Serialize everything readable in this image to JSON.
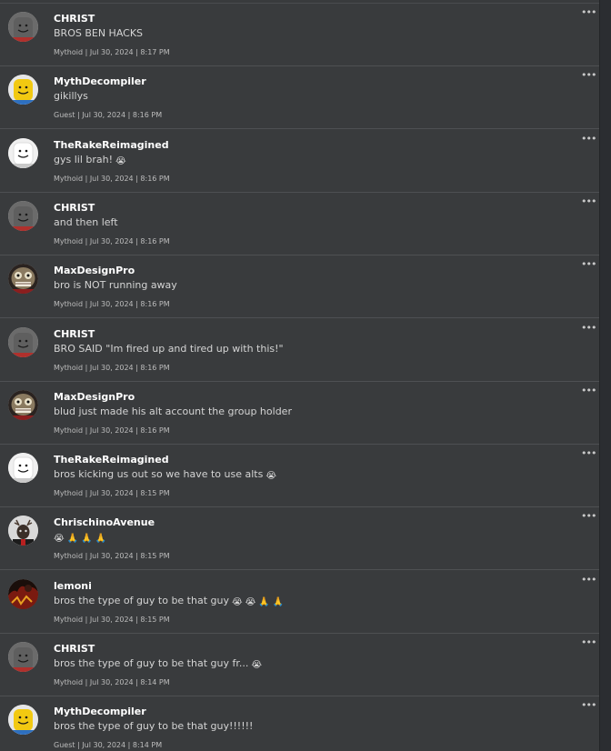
{
  "more_label": "•••",
  "comments": [
    {
      "user": "CHRIST",
      "text": "BROS BEN HACKS",
      "meta": "Mythoid | Jul 30, 2024 | 8:17 PM",
      "avatar": "gray-face",
      "emoji": []
    },
    {
      "user": "MythDecompiler",
      "text": "gikillys",
      "meta": "Guest | Jul 30, 2024 | 8:16 PM",
      "avatar": "yellow-face",
      "emoji": []
    },
    {
      "user": "TheRakeReimagined",
      "text": "gys lil brah!",
      "meta": "Mythoid | Jul 30, 2024 | 8:16 PM",
      "avatar": "white-face",
      "emoji": [
        "😭"
      ]
    },
    {
      "user": "CHRIST",
      "text": "and then left",
      "meta": "Mythoid | Jul 30, 2024 | 8:16 PM",
      "avatar": "gray-face",
      "emoji": []
    },
    {
      "user": "MaxDesignPro",
      "text": "bro is NOT running away",
      "meta": "Mythoid | Jul 30, 2024 | 8:16 PM",
      "avatar": "monster-face",
      "emoji": []
    },
    {
      "user": "CHRIST",
      "text": "BRO SAID \"Im fired up and tired up with this!\"",
      "meta": "Mythoid | Jul 30, 2024 | 8:16 PM",
      "avatar": "gray-face",
      "emoji": []
    },
    {
      "user": "MaxDesignPro",
      "text": "blud just made his alt account the group holder",
      "meta": "Mythoid | Jul 30, 2024 | 8:16 PM",
      "avatar": "monster-face",
      "emoji": []
    },
    {
      "user": "TheRakeReimagined",
      "text": "bros kicking us out so we have to use alts",
      "meta": "Mythoid | Jul 30, 2024 | 8:15 PM",
      "avatar": "white-face",
      "emoji": [
        "😭"
      ]
    },
    {
      "user": "ChrischinoAvenue",
      "text": "",
      "meta": "Mythoid | Jul 30, 2024 | 8:15 PM",
      "avatar": "deer-face",
      "emoji": [
        "😭",
        "🙏",
        "🙏",
        "🙏"
      ]
    },
    {
      "user": "lemoni",
      "text": "bros the type of guy to be that guy",
      "meta": "Mythoid | Jul 30, 2024 | 8:15 PM",
      "avatar": "dark-red-face",
      "emoji": [
        "😭",
        "😭",
        "🙏",
        "🙏"
      ]
    },
    {
      "user": "CHRIST",
      "text": "bros the type of guy to be that guy fr...",
      "meta": "Mythoid | Jul 30, 2024 | 8:14 PM",
      "avatar": "gray-face",
      "emoji": [
        "😭"
      ]
    },
    {
      "user": "MythDecompiler",
      "text": "bros the type of guy to be that guy!!!!!!",
      "meta": "Guest | Jul 30, 2024 | 8:14 PM",
      "avatar": "yellow-face",
      "emoji": []
    }
  ]
}
